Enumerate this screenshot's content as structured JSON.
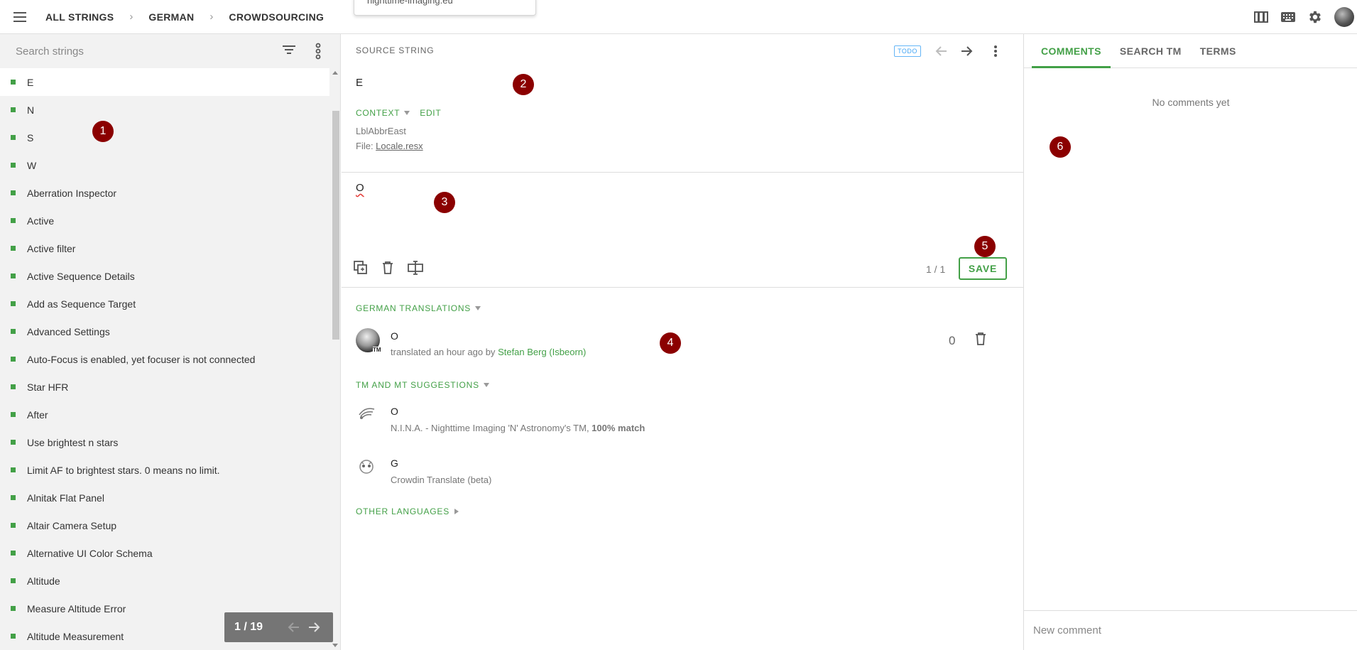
{
  "header": {
    "breadcrumbs": [
      "ALL STRINGS",
      "GERMAN",
      "CROWDSOURCING"
    ],
    "dropdown_fragment": "nighttime-imaging.eu"
  },
  "sidebar": {
    "search_placeholder": "Search strings",
    "items": [
      "E",
      "N",
      "S",
      "W",
      "Aberration Inspector",
      "Active",
      "Active filter",
      "Active Sequence Details",
      "Add as Sequence Target",
      "Advanced Settings",
      "Auto-Focus is enabled, yet focuser is not connected",
      "Star HFR",
      "After",
      "Use brightest n stars",
      "Limit AF to brightest stars. 0 means no limit.",
      "Alnitak Flat Panel",
      "Altair Camera Setup",
      "Alternative UI Color Schema",
      "Altitude",
      "Measure Altitude Error",
      "Altitude Measurement"
    ],
    "pager": "1 / 19",
    "status_color": "#43a047"
  },
  "source": {
    "label": "SOURCE STRING",
    "status": "TODO",
    "text": "E",
    "context_label": "CONTEXT",
    "edit_label": "EDIT",
    "key": "LblAbbrEast",
    "file_prefix": "File: ",
    "file_name": "Locale.resx"
  },
  "editor": {
    "value": "O",
    "counter": "1 / 1",
    "save_label": "SAVE"
  },
  "translations": {
    "label": "GERMAN TRANSLATIONS",
    "items": [
      {
        "text": "O",
        "meta_prefix": "translated an hour ago by ",
        "author": "Stefan Berg (Isbeorn)",
        "votes": "0",
        "tm_mark": "TM"
      }
    ]
  },
  "suggestions": {
    "label": "TM AND MT SUGGESTIONS",
    "items": [
      {
        "text": "O",
        "source": "N.I.N.A. - Nighttime Imaging 'N' Astronomy's TM, ",
        "match": "100% match",
        "icon": "tm-icon"
      },
      {
        "text": "G",
        "source": "Crowdin Translate (beta)",
        "match": "",
        "icon": "crowdin-icon"
      }
    ]
  },
  "other_languages": {
    "label": "OTHER LANGUAGES"
  },
  "right_panel": {
    "tabs": [
      "COMMENTS",
      "SEARCH TM",
      "TERMS"
    ],
    "empty_text": "No comments yet",
    "comment_placeholder": "New comment"
  },
  "badges": [
    "1",
    "2",
    "3",
    "4",
    "5",
    "6"
  ],
  "colors": {
    "accent": "#43a047",
    "badge": "#8b0000",
    "todo": "#42a5f5"
  }
}
